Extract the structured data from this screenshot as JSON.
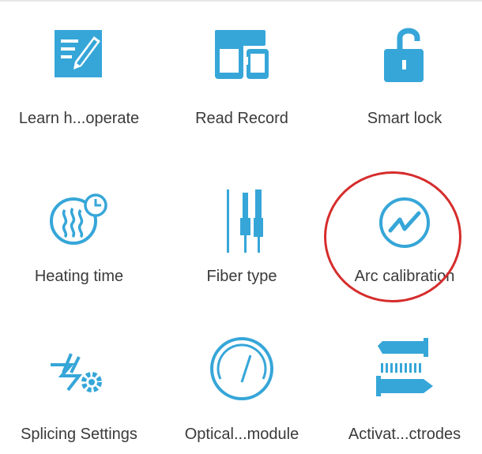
{
  "menu": {
    "items": [
      {
        "label": "Learn h...operate",
        "icon": "edit-note-icon"
      },
      {
        "label": "Read Record",
        "icon": "devices-icon"
      },
      {
        "label": "Smart lock",
        "icon": "unlock-icon"
      },
      {
        "label": "Heating time",
        "icon": "heater-timer-icon"
      },
      {
        "label": "Fiber type",
        "icon": "fiber-icon"
      },
      {
        "label": "Arc calibration",
        "icon": "arc-pulse-icon"
      },
      {
        "label": "Splicing Settings",
        "icon": "splice-gear-icon"
      },
      {
        "label": "Optical...module",
        "icon": "gauge-icon"
      },
      {
        "label": "Activat...ctrodes",
        "icon": "electrode-icon"
      }
    ]
  },
  "colors": {
    "accent": "#36a6d8",
    "highlight": "#d62c2c",
    "text": "#3a3a3a"
  }
}
